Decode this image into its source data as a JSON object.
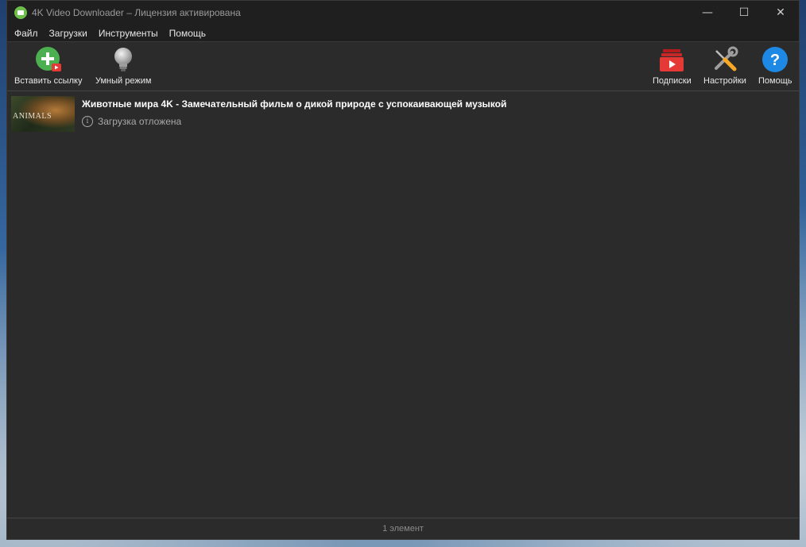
{
  "window": {
    "title": "4K Video Downloader – Лицензия активирована",
    "controls": {
      "minimize": "—",
      "maximize": "☐",
      "close": "✕"
    }
  },
  "menu": {
    "items": [
      {
        "label": "Файл"
      },
      {
        "label": "Загрузки"
      },
      {
        "label": "Инструменты"
      },
      {
        "label": "Помощь"
      }
    ]
  },
  "toolbar": {
    "paste_link": {
      "label": "Вставить ссылку",
      "icon": "paste-link-icon"
    },
    "smart_mode": {
      "label": "Умный режим",
      "icon": "lightbulb-icon"
    },
    "subscriptions": {
      "label": "Подписки",
      "icon": "subscriptions-icon"
    },
    "settings": {
      "label": "Настройки",
      "icon": "wrench-screwdriver-icon"
    },
    "help": {
      "label": "Помощь",
      "icon": "help-icon"
    }
  },
  "downloads": [
    {
      "title": "Животные мира 4K - Замечательный фильм о дикой природе с успокаивающей музыкой",
      "status": "Загрузка отложена",
      "thumbnail_text": "ANIMALS"
    }
  ],
  "statusbar": {
    "text": "1 элемент"
  },
  "colors": {
    "window_bg": "#2b2b2b",
    "titlebar_bg": "#1f1f1f",
    "accent_green": "#6cc04a",
    "accent_red": "#d32f2f",
    "accent_blue": "#1e88e5"
  }
}
